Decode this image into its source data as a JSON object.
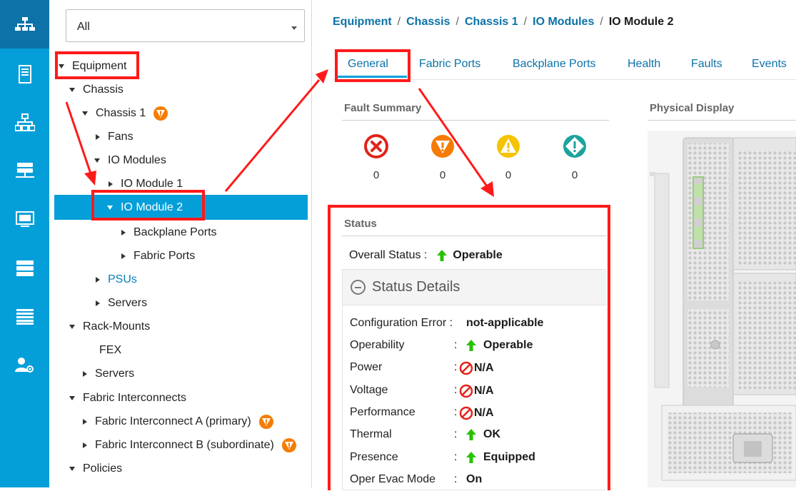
{
  "filter": {
    "value": "All"
  },
  "tree": {
    "equipment": "Equipment",
    "chassis": "Chassis",
    "chassis1": "Chassis 1",
    "fans": "Fans",
    "io_modules": "IO Modules",
    "io_module_1": "IO Module 1",
    "io_module_2": "IO Module 2",
    "backplane_ports": "Backplane Ports",
    "fabric_ports": "Fabric Ports",
    "psus": "PSUs",
    "servers": "Servers",
    "rack_mounts": "Rack-Mounts",
    "fex": "FEX",
    "rack_servers": "Servers",
    "fabric_interconnects": "Fabric Interconnects",
    "fi_a": "Fabric Interconnect A (primary)",
    "fi_b": "Fabric Interconnect B (subordinate)",
    "policies": "Policies"
  },
  "breadcrumb": {
    "items": [
      "Equipment",
      "Chassis",
      "Chassis 1",
      "IO Modules"
    ],
    "separator": "/",
    "current": "IO Module 2"
  },
  "tabs": [
    "General",
    "Fabric Ports",
    "Backplane Ports",
    "Health",
    "Faults",
    "Events"
  ],
  "fault_summary": {
    "title": "Fault Summary",
    "critical": "0",
    "major": "0",
    "minor": "0",
    "warning": "0"
  },
  "physical_display": {
    "title": "Physical Display"
  },
  "status": {
    "title": "Status",
    "overall_label": "Overall Status :",
    "overall_value": "Operable",
    "details_title": "Status Details",
    "rows": [
      {
        "label": "Configuration Error :",
        "colon": "",
        "value": "not-applicable"
      },
      {
        "label": "Operability",
        "colon": ":",
        "value": "Operable"
      },
      {
        "label": "Power",
        "colon": ":",
        "value": "N/A"
      },
      {
        "label": "Voltage",
        "colon": ":",
        "value": "N/A"
      },
      {
        "label": "Performance",
        "colon": ":",
        "value": "N/A"
      },
      {
        "label": "Thermal",
        "colon": ":",
        "value": "OK"
      },
      {
        "label": "Presence",
        "colon": ":",
        "value": "Equipped"
      },
      {
        "label": "Oper Evac Mode",
        "colon": ":",
        "value": "On"
      }
    ]
  },
  "colors": {
    "rail": "#049fd9",
    "rail_active": "#0c72a8",
    "link": "#0c72a8",
    "critical": "#e2231a",
    "major": "#f57c00",
    "minor": "#f5c300",
    "warning": "#1ba39c",
    "ok_green": "#27c200",
    "annotation": "#ff1a1a"
  },
  "rail_icons": [
    "equipment-icon",
    "server-icon",
    "network-icon",
    "san-icon",
    "vm-icon",
    "storage-icon",
    "chassis-icon",
    "admin-icon"
  ]
}
